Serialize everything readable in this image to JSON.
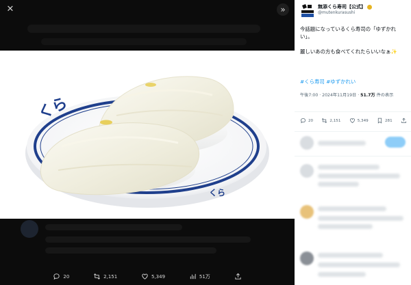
{
  "viewer": {
    "close_icon": "close-icon",
    "expand_icon": "expand-icon",
    "photo_alt": "",
    "actions": [
      {
        "icon": "reply-icon",
        "count": "20"
      },
      {
        "icon": "retweet-icon",
        "count": "2,151"
      },
      {
        "icon": "like-icon",
        "count": "5,349"
      },
      {
        "icon": "views-icon",
        "count": "51万"
      },
      {
        "icon": "share-icon",
        "count": ""
      }
    ]
  },
  "tweet": {
    "author_name": "無添くら寿司【公式】",
    "handle": "@mutenkurasushi",
    "text_line1": "今話題になっているくら寿司の「ゆずかれい」。",
    "text_line2": "麗しいあの方も食べてくれたらいいなぁ✨",
    "hashtags": "#くら寿司 #ゆずかれい",
    "time": "午後7:00 · 2024年11月19日 · ",
    "views_count": "51.7万",
    "views_suffix": " 件の表示",
    "actions": [
      {
        "icon": "reply-icon",
        "count": "20"
      },
      {
        "icon": "retweet-icon",
        "count": "2,151"
      },
      {
        "icon": "like-icon",
        "count": "5,349"
      },
      {
        "icon": "bookmark-icon",
        "count": "281"
      },
      {
        "icon": "share-icon",
        "count": ""
      }
    ]
  },
  "colors": {
    "link": "#1d9bf0",
    "secondary_text": "#536471",
    "viewer_bg": "#0c0c0c",
    "plate_rim": "#1f3f8c"
  }
}
